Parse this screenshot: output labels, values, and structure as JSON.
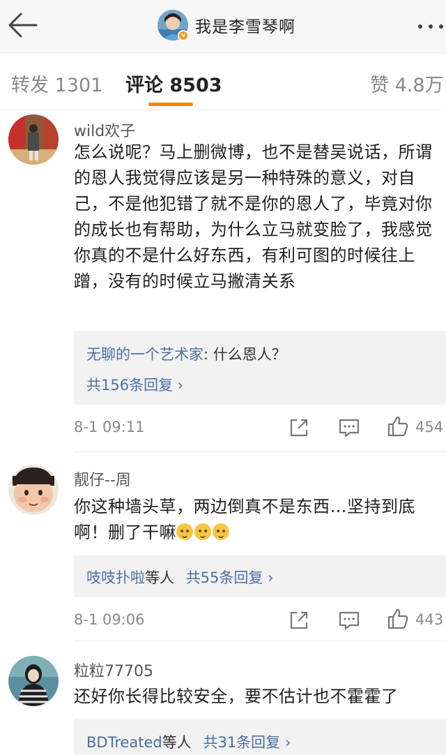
{
  "header": {
    "title": "我是李雪琴啊",
    "badge": "v",
    "icons": {
      "back": "back-arrow-icon",
      "more": "more-dots-icon"
    }
  },
  "tabs": [
    {
      "label": "转发 1301",
      "active": false
    },
    {
      "label": "评论 8503",
      "active": true
    },
    {
      "label": "赞 4.8万",
      "active": false
    }
  ],
  "colors": {
    "accent": "#ff8200",
    "link": "#4a6fa5",
    "meta": "#8a8a8a",
    "reply_bg": "#f2f2f2",
    "verified_badge": "#f59b21"
  },
  "comments": [
    {
      "user": "wild欢子",
      "text": "怎么说呢？马上删微博，也不是替吴说话，所谓的恩人我觉得应该是另一种特殊的意义，对自己，不是他犯错了就不是你的恩人了，毕竟对你的成长也有帮助，为什么立马就变脸了，我感觉你真的不是什么好东西，有利可图的时候往上蹭，没有的时候立马撇清关系",
      "reply_preview": {
        "user": "无聊的一个艺术家",
        "text": ": 什么恩人？"
      },
      "reply_count": "共156条回复 ›",
      "time": "8-1 09:11",
      "likes": "454"
    },
    {
      "user": "靓仔--周",
      "text": "你这种墙头草，两边倒真不是东西…坚持到底啊！删了干嘛",
      "emojis": [
        "doge-emoji",
        "doge-emoji",
        "doge-emoji"
      ],
      "reply_preview": {
        "user": "吱吱扑啦",
        "text": "等人"
      },
      "reply_count": "共55条回复 ›",
      "time": "8-1 09:06",
      "likes": "443"
    },
    {
      "user": "粒粒77705",
      "text": "还好你长得比较安全，要不估计也不霍霍了",
      "reply_preview": {
        "user": "BDTreated",
        "text": "等人"
      },
      "reply_count": "共31条回复 ›"
    }
  ],
  "action_icons": [
    "share-icon",
    "comment-icon",
    "like-icon"
  ]
}
